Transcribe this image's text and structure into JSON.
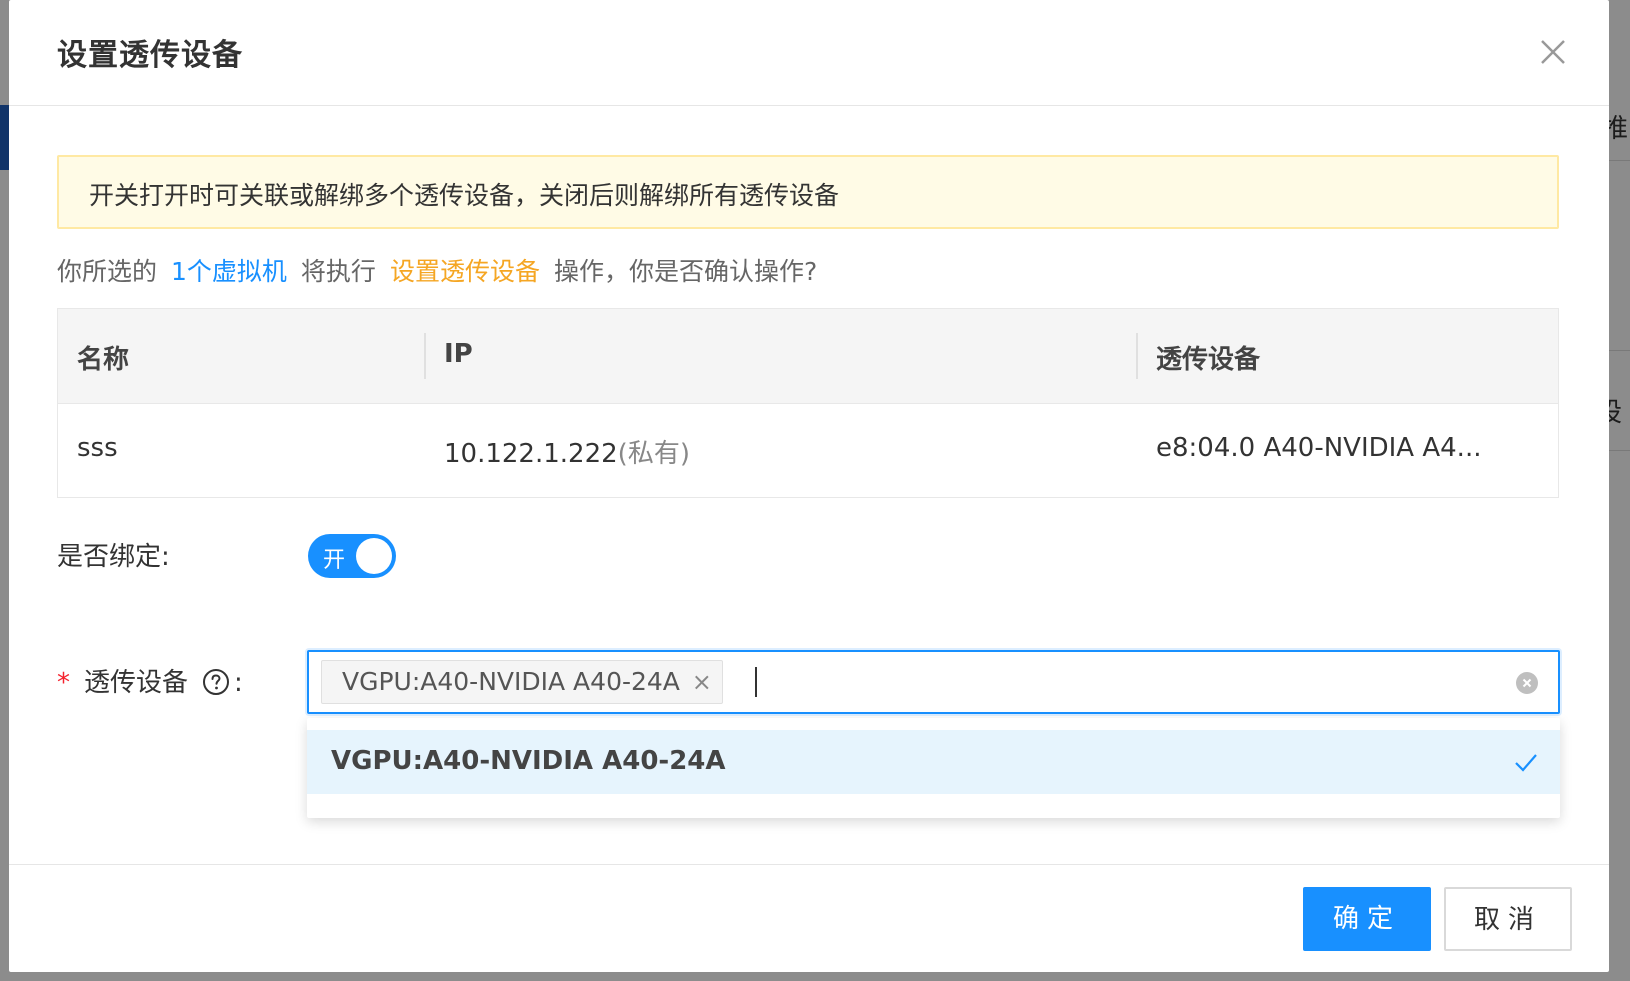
{
  "background": {
    "fragments": [
      "推",
      "设"
    ]
  },
  "modal": {
    "title": "设置透传设备",
    "notice": "开关打开时可关联或解绑多个透传设备，关闭后则解绑所有透传设备",
    "confirm": {
      "prefix": "你所选的",
      "target": "1个虚拟机",
      "middle": "将执行",
      "action": "设置透传设备",
      "suffix": "操作，你是否确认操作?"
    },
    "table": {
      "headers": [
        "名称",
        "IP",
        "透传设备"
      ],
      "rows": [
        {
          "name": "sss",
          "ip": "10.122.1.222",
          "ip_note": "(私有)",
          "device": "e8:04.0 A40-NVIDIA A4..."
        }
      ]
    },
    "bind": {
      "label": "是否绑定:",
      "switch_text": "开",
      "on": true
    },
    "device_field": {
      "required_mark": "*",
      "label": "透传设备",
      "colon": ":",
      "selected_tags": [
        "VGPU:A40-NVIDIA A40-24A"
      ],
      "tag_close": "×",
      "options": [
        {
          "label": "VGPU:A40-NVIDIA A40-24A",
          "selected": true
        }
      ]
    },
    "footer": {
      "ok_label": "确定",
      "cancel_label": "取消"
    }
  },
  "colors": {
    "primary": "#1890ff",
    "warning_text": "#f5a623",
    "notice_bg": "#fffbe6",
    "required": "#f5222d",
    "option_highlight": "#e6f4fd"
  }
}
